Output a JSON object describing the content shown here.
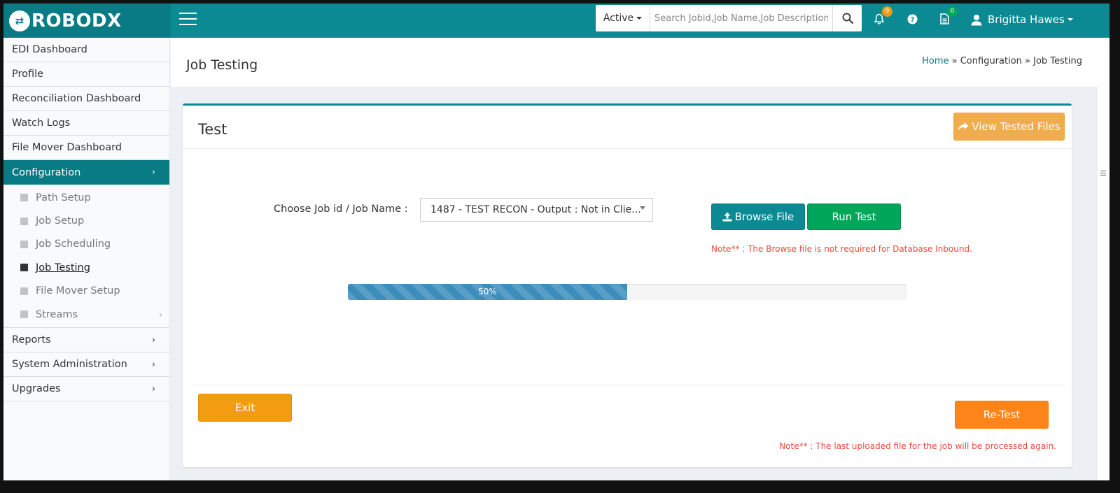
{
  "app": {
    "logo_text": "ROBODX"
  },
  "header": {
    "status_filter": "Active",
    "search_placeholder": "Search Jobid,Job Name,Job Description,FileName",
    "notifications_count": "9",
    "tasks_count": "0",
    "user_name": "Brigitta Hawes"
  },
  "sidebar": {
    "items": [
      {
        "label": "EDI Dashboard"
      },
      {
        "label": "Profile"
      },
      {
        "label": "Reconciliation Dashboard"
      },
      {
        "label": "Watch Logs"
      },
      {
        "label": "File Mover Dashboard"
      },
      {
        "label": "Configuration"
      },
      {
        "label": "Reports"
      },
      {
        "label": "System Administration"
      },
      {
        "label": "Upgrades"
      }
    ],
    "config_sub": [
      {
        "label": "Path Setup"
      },
      {
        "label": "Job Setup"
      },
      {
        "label": "Job Scheduling"
      },
      {
        "label": "Job Testing"
      },
      {
        "label": "File Mover Setup"
      },
      {
        "label": "Streams"
      }
    ]
  },
  "page": {
    "title": "Job Testing",
    "breadcrumb": {
      "home": "Home",
      "sep1": " » ",
      "section": "Configuration",
      "sep2": " » ",
      "current": "Job Testing"
    }
  },
  "test_box": {
    "title": "Test",
    "view_tested_files": "View Tested Files",
    "job_label": "Choose Job id / Job Name :",
    "job_selected": "1487 - TEST RECON - Output : Not in Clie...",
    "browse_label": "Browse File",
    "run_label": "Run Test",
    "browse_note": "Note** : The Browse file is not required for Database Inbound.",
    "progress_percent": 50,
    "progress_label": "50%",
    "exit_label": "Exit",
    "retest_label": "Re-Test",
    "retest_note": "Note** : The last uploaded file for the job will be processed again."
  },
  "colors": {
    "header": "#0b8a94",
    "accent": "#097b84",
    "warning": "#f0ad4e",
    "success": "#00a65a",
    "danger_text": "#e74c3c",
    "progress": "#3c8dbc"
  }
}
